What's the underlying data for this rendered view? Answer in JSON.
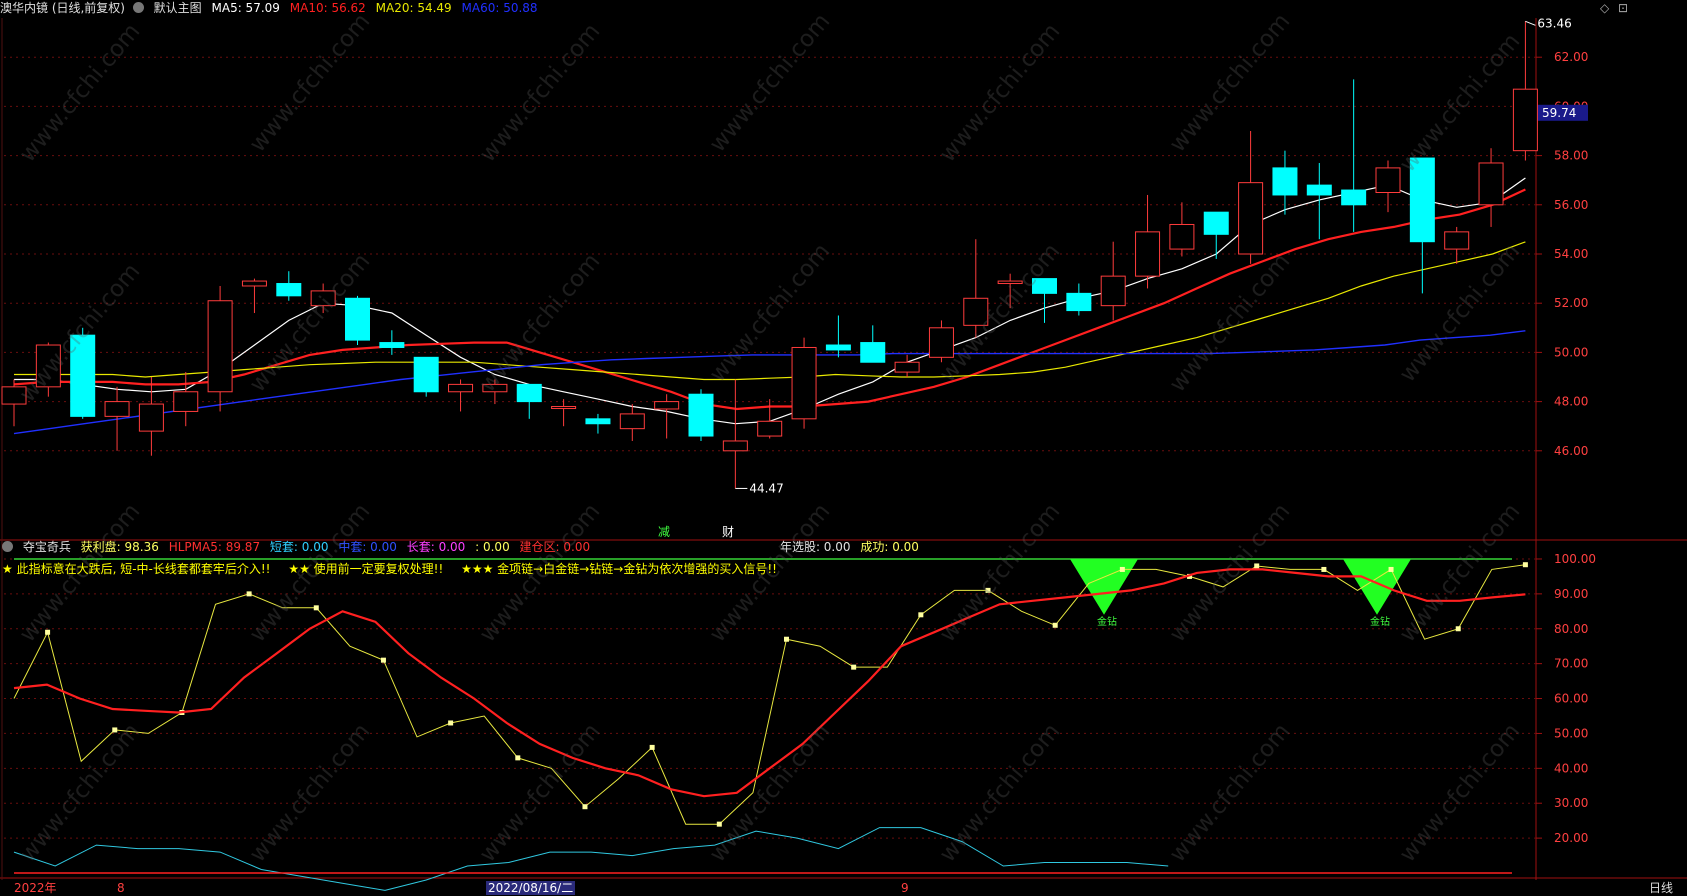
{
  "header": {
    "title": "澳华内镜 (日线,前复权)",
    "mode": "默认主图",
    "ma5": "MA5: 57.09",
    "ma10": "MA10: 56.62",
    "ma20": "MA20: 54.49",
    "ma60": "MA60: 50.88",
    "current_price": "59.74",
    "colors": {
      "ma5": "#ffffff",
      "ma10": "#ff2020",
      "ma20": "#e8e800",
      "ma60": "#2030ff"
    }
  },
  "indicator_header": {
    "name": "夺宝奇兵",
    "profit": "获利盘: 98.36",
    "hlpma5": "HLPMA5: 89.87",
    "short": "短套: 0.00",
    "mid": "中套: 0.00",
    "long": "长套: 0.00",
    "colon": ": 0.00",
    "build": "建仓区: 0.00",
    "year_pick": "年选股: 0.00",
    "success": "成功: 0.00"
  },
  "notes": [
    "★ 此指标意在大跌后, 短-中-长线套都套牢后介入!!",
    "★★ 使用前一定要复权处理!!",
    "★★★ 金项链→白金链→钻链→金钻为依次增强的买入信号!!"
  ],
  "x_axis": {
    "labels": [
      "2022年",
      "8",
      "2022/08/16/二",
      "9"
    ],
    "right_label": "日线"
  },
  "watermark": "www.cfchi.com",
  "chart_data": [
    {
      "type": "candlestick",
      "ylim": [
        44.0,
        64.0
      ],
      "y_ticks": [
        46,
        48,
        50,
        52,
        54,
        56,
        58,
        60,
        62
      ],
      "y_tick_labels": [
        "46.00",
        "48.00",
        "50.00",
        "52.00",
        "54.00",
        "56.00",
        "58.00",
        "60.00",
        "62.00"
      ],
      "candles": [
        {
          "o": 47.9,
          "h": 48.9,
          "l": 47.0,
          "c": 48.6
        },
        {
          "o": 48.6,
          "h": 50.4,
          "l": 48.2,
          "c": 50.3
        },
        {
          "o": 50.7,
          "h": 51.0,
          "l": 47.3,
          "c": 47.4
        },
        {
          "o": 47.4,
          "h": 48.6,
          "l": 46.0,
          "c": 48.0
        },
        {
          "o": 46.8,
          "h": 49.0,
          "l": 45.8,
          "c": 47.9
        },
        {
          "o": 47.6,
          "h": 49.2,
          "l": 47.0,
          "c": 48.4
        },
        {
          "o": 48.4,
          "h": 52.7,
          "l": 47.6,
          "c": 52.1
        },
        {
          "o": 52.7,
          "h": 53.0,
          "l": 51.6,
          "c": 52.9
        },
        {
          "o": 52.8,
          "h": 53.3,
          "l": 52.1,
          "c": 52.3
        },
        {
          "o": 51.9,
          "h": 52.8,
          "l": 51.6,
          "c": 52.5
        },
        {
          "o": 52.2,
          "h": 52.3,
          "l": 50.3,
          "c": 50.5
        },
        {
          "o": 50.4,
          "h": 50.9,
          "l": 49.9,
          "c": 50.2
        },
        {
          "o": 49.8,
          "h": 49.8,
          "l": 48.2,
          "c": 48.4
        },
        {
          "o": 48.4,
          "h": 48.9,
          "l": 47.6,
          "c": 48.7
        },
        {
          "o": 48.4,
          "h": 48.9,
          "l": 47.9,
          "c": 48.7
        },
        {
          "o": 48.7,
          "h": 48.7,
          "l": 47.3,
          "c": 48.0
        },
        {
          "o": 47.8,
          "h": 48.1,
          "l": 47.0,
          "c": 47.8
        },
        {
          "o": 47.3,
          "h": 47.5,
          "l": 46.7,
          "c": 47.1
        },
        {
          "o": 46.9,
          "h": 47.9,
          "l": 46.4,
          "c": 47.5
        },
        {
          "o": 47.7,
          "h": 48.3,
          "l": 46.5,
          "c": 48.0
        },
        {
          "o": 48.3,
          "h": 48.5,
          "l": 46.4,
          "c": 46.6
        },
        {
          "o": 46.0,
          "h": 48.9,
          "l": 44.47,
          "c": 46.4
        },
        {
          "o": 46.6,
          "h": 48.1,
          "l": 46.5,
          "c": 47.2
        },
        {
          "o": 47.3,
          "h": 50.6,
          "l": 46.9,
          "c": 50.2
        },
        {
          "o": 50.3,
          "h": 51.5,
          "l": 49.8,
          "c": 50.1
        },
        {
          "o": 50.4,
          "h": 51.1,
          "l": 49.8,
          "c": 49.6
        },
        {
          "o": 49.2,
          "h": 49.9,
          "l": 49.0,
          "c": 49.6
        },
        {
          "o": 49.8,
          "h": 51.3,
          "l": 49.6,
          "c": 51.0
        },
        {
          "o": 51.1,
          "h": 54.6,
          "l": 50.6,
          "c": 52.2
        },
        {
          "o": 52.8,
          "h": 53.2,
          "l": 51.8,
          "c": 52.9
        },
        {
          "o": 53.0,
          "h": 53.0,
          "l": 51.2,
          "c": 52.4
        },
        {
          "o": 52.4,
          "h": 52.8,
          "l": 51.5,
          "c": 51.7
        },
        {
          "o": 51.9,
          "h": 54.5,
          "l": 51.3,
          "c": 53.1
        },
        {
          "o": 53.1,
          "h": 56.4,
          "l": 52.6,
          "c": 54.9
        },
        {
          "o": 54.2,
          "h": 56.1,
          "l": 53.9,
          "c": 55.2
        },
        {
          "o": 55.7,
          "h": 55.7,
          "l": 53.8,
          "c": 54.8
        },
        {
          "o": 54.0,
          "h": 59.0,
          "l": 53.6,
          "c": 56.9
        },
        {
          "o": 57.5,
          "h": 58.2,
          "l": 55.6,
          "c": 56.4
        },
        {
          "o": 56.8,
          "h": 57.7,
          "l": 54.6,
          "c": 56.4
        },
        {
          "o": 56.6,
          "h": 61.1,
          "l": 54.9,
          "c": 56.0
        },
        {
          "o": 56.5,
          "h": 57.8,
          "l": 55.7,
          "c": 57.5
        },
        {
          "o": 57.9,
          "h": 57.9,
          "l": 52.4,
          "c": 54.5
        },
        {
          "o": 54.2,
          "h": 55.1,
          "l": 53.6,
          "c": 54.9
        },
        {
          "o": 56.0,
          "h": 58.3,
          "l": 55.1,
          "c": 57.7
        },
        {
          "o": 58.2,
          "h": 63.46,
          "l": 57.8,
          "c": 60.7
        }
      ],
      "series": [
        {
          "name": "MA5",
          "values": [
            48.9,
            48.9,
            48.7,
            48.5,
            48.4,
            48.5,
            49.3,
            50.3,
            51.3,
            52.0,
            51.9,
            51.6,
            50.7,
            49.8,
            49.1,
            48.7,
            48.4,
            48.1,
            47.8,
            47.6,
            47.3,
            47.1,
            47.2,
            47.7,
            48.3,
            48.8,
            49.6,
            50.1,
            50.6,
            51.3,
            51.8,
            52.2,
            52.5,
            53.0,
            53.4,
            54.0,
            55.2,
            55.8,
            56.2,
            56.5,
            56.8,
            56.2,
            55.9,
            56.1,
            57.09
          ]
        },
        {
          "name": "MA10",
          "values": [
            48.7,
            48.8,
            48.8,
            48.8,
            48.7,
            48.7,
            48.8,
            49.1,
            49.5,
            49.9,
            50.1,
            50.2,
            50.3,
            50.35,
            50.4,
            50.4,
            50.0,
            49.6,
            49.2,
            48.8,
            48.4,
            47.9,
            47.7,
            47.8,
            47.8,
            47.9,
            48.0,
            48.3,
            48.6,
            49.0,
            49.5,
            50.0,
            50.5,
            51.0,
            51.5,
            52.0,
            52.6,
            53.2,
            53.7,
            54.2,
            54.6,
            54.9,
            55.1,
            55.4,
            55.6,
            56.0,
            56.62
          ]
        },
        {
          "name": "MA20",
          "values": [
            49.1,
            49.1,
            49.1,
            49.1,
            49.0,
            49.1,
            49.2,
            49.3,
            49.4,
            49.5,
            49.55,
            49.6,
            49.6,
            49.6,
            49.6,
            49.5,
            49.4,
            49.3,
            49.2,
            49.1,
            49.0,
            48.9,
            48.9,
            48.95,
            49.0,
            49.1,
            49.05,
            49.0,
            49.0,
            49.05,
            49.1,
            49.2,
            49.4,
            49.7,
            50.0,
            50.3,
            50.6,
            51.0,
            51.4,
            51.8,
            52.2,
            52.7,
            53.1,
            53.4,
            53.7,
            54.0,
            54.49
          ]
        },
        {
          "name": "MA60",
          "values": [
            46.7,
            46.9,
            47.1,
            47.3,
            47.5,
            47.7,
            47.9,
            48.1,
            48.3,
            48.5,
            48.7,
            48.9,
            49.05,
            49.2,
            49.35,
            49.5,
            49.6,
            49.7,
            49.75,
            49.8,
            49.85,
            49.9,
            49.9,
            49.9,
            49.9,
            49.95,
            49.95,
            49.95,
            49.95,
            49.95,
            49.95,
            49.95,
            49.95,
            49.95,
            49.95,
            50.0,
            50.05,
            50.1,
            50.2,
            50.3,
            50.5,
            50.6,
            50.7,
            50.88
          ]
        }
      ],
      "annotations": {
        "high": "63.46",
        "low": "44.47",
        "markers": [
          "减",
          "财"
        ]
      }
    },
    {
      "type": "line",
      "ylim": [
        10,
        102
      ],
      "y_ticks": [
        20,
        30,
        40,
        50,
        60,
        70,
        80,
        90,
        100
      ],
      "y_tick_labels": [
        "20.00",
        "30.00",
        "40.00",
        "50.00",
        "60.00",
        "70.00",
        "80.00",
        "90.00",
        "100.00"
      ],
      "series": [
        {
          "name": "获利盘",
          "values": [
            60,
            79,
            42,
            51,
            50,
            56,
            87,
            90,
            86,
            86,
            75,
            71,
            49,
            53,
            55,
            43,
            40,
            29,
            37,
            46,
            24,
            24,
            33,
            77,
            75,
            69,
            69,
            84,
            91,
            91,
            85,
            81,
            93,
            97,
            97,
            95,
            92,
            98,
            97,
            97,
            91,
            97,
            77,
            80,
            97,
            98.36
          ]
        },
        {
          "name": "HLPMA5",
          "values": [
            63,
            64,
            60,
            57,
            56.5,
            56,
            57,
            66,
            73,
            80,
            85,
            82,
            73,
            66,
            60,
            53,
            47,
            43,
            40,
            38,
            34,
            32,
            33,
            40,
            47,
            56,
            65,
            75,
            79,
            83,
            87,
            88,
            89,
            90,
            91,
            93,
            96,
            97,
            97,
            96,
            95,
            95,
            91,
            88,
            88,
            89,
            89.87
          ]
        },
        {
          "name": "cyan",
          "values": [
            16,
            12,
            18,
            17,
            17,
            16,
            11,
            9,
            7,
            5,
            8,
            12,
            13,
            16,
            16,
            15,
            17,
            18,
            22,
            20,
            17,
            23,
            23,
            19,
            12,
            13,
            13,
            13,
            12
          ]
        },
        {
          "name": "top",
          "values": [
            100,
            100
          ]
        }
      ],
      "signals": [
        "金钻",
        "金钻"
      ]
    }
  ]
}
